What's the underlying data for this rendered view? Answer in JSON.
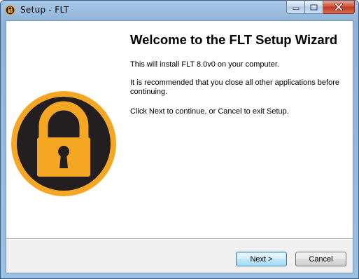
{
  "window": {
    "title": "Setup - FLT"
  },
  "caption_buttons": {
    "minimize_icon": "minimize-icon",
    "maximize_icon": "maximize-icon",
    "close_icon": "close-icon"
  },
  "side_panel": {
    "graphic": "padlock-icon",
    "colors": {
      "ring": "#f5a623",
      "disc": "#231f20",
      "lock_body": "#f5a623",
      "keyhole": "#231f20"
    }
  },
  "main": {
    "heading": "Welcome to the FLT Setup Wizard",
    "paragraph_1": "This will install FLT 8.0v0 on your computer.",
    "paragraph_2": "It is recommended that you close all other applications before continuing.",
    "paragraph_3": "Click Next to continue, or Cancel to exit Setup."
  },
  "footer": {
    "next_label": "Next >",
    "cancel_label": "Cancel"
  }
}
